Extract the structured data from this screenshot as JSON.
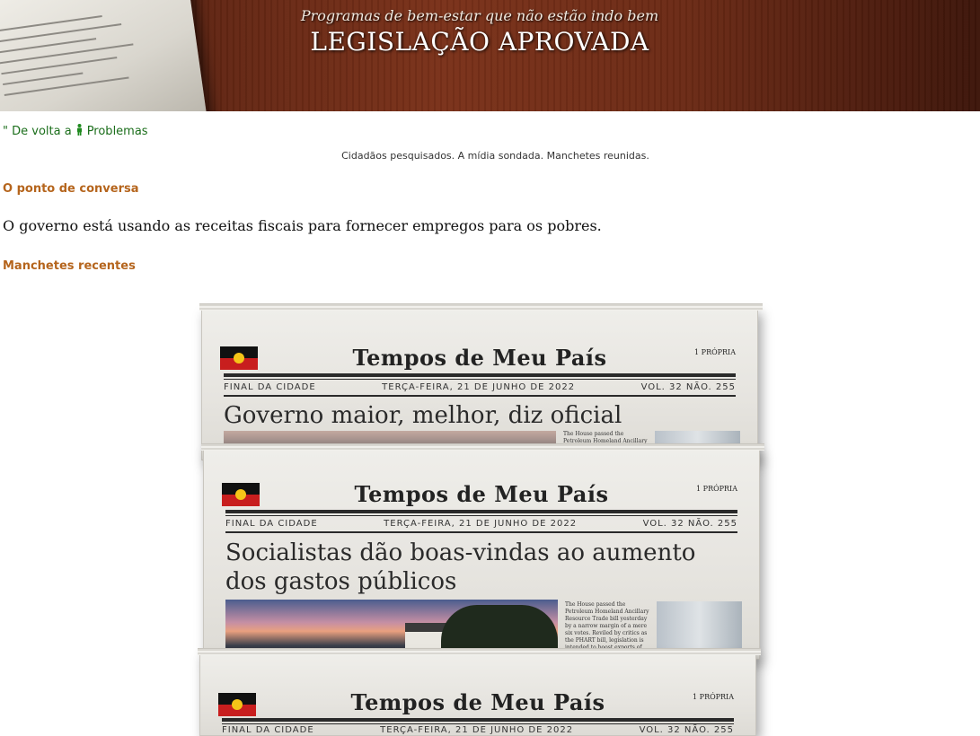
{
  "banner": {
    "subtitle": "Programas de bem-estar que não estão indo bem",
    "title": "LEGISLAÇÃO APROVADA"
  },
  "nav": {
    "back_prefix": "\" De volta a",
    "back_link": "Problemas"
  },
  "tagline": "Cidadãos pesquisados. A mídia sondada. Manchetes reunidas.",
  "talking_point": {
    "heading": "O ponto de conversa",
    "text": "O governo está usando as receitas fiscais para fornecer empregos para os pobres."
  },
  "recent": {
    "heading": "Manchetes recentes"
  },
  "newspapers": [
    {
      "masthead": "Tempos de Meu País",
      "edition": "1 PRÓPRIA",
      "section": "FINAL DA CIDADE",
      "date": "TERÇA-FEIRA, 21 DE JUNHO DE 2022",
      "volume": "VOL. 32 NÃO. 255",
      "headline": "Governo maior, melhor, diz oficial",
      "column_text": "The House passed the Petroleum Homeland Ancillary Resource Trade"
    },
    {
      "masthead": "Tempos de Meu País",
      "edition": "1 PRÓPRIA",
      "section": "FINAL DA CIDADE",
      "date": "TERÇA-FEIRA, 21 DE JUNHO DE 2022",
      "volume": "VOL. 32 NÃO. 255",
      "headline": "Socialistas dão boas-vindas ao aumento dos gastos públicos",
      "column_text": "The House passed the Petroleum Homeland Ancillary Resource Trade bill yesterday by a narrow margin of a mere six votes. Reviled by critics as the PHART bill, legislation is intended to boost exports of bio-mass and other"
    },
    {
      "masthead": "Tempos de Meu País",
      "edition": "1 PRÓPRIA",
      "section": "FINAL DA CIDADE",
      "date": "TERÇA-FEIRA, 21 DE JUNHO DE 2022",
      "volume": "VOL. 32 NÃO. 255"
    }
  ],
  "colors": {
    "link_green": "#1b6e1b",
    "heading_orange": "#b5651d",
    "banner_wood": "#6b2a15"
  },
  "icons": {
    "person": "person-icon"
  }
}
